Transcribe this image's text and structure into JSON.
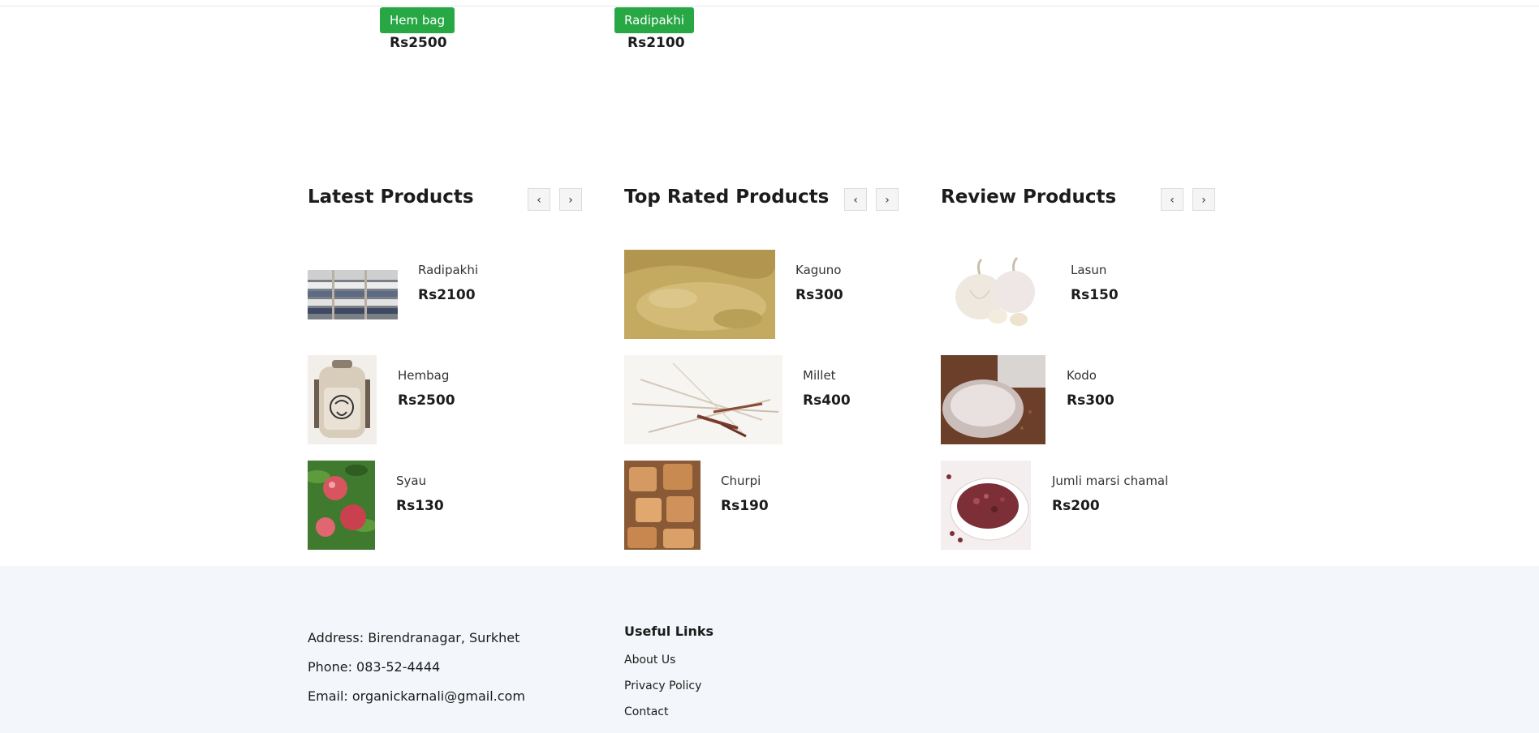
{
  "featured": [
    {
      "tag": "Hem bag",
      "price": "Rs2500"
    },
    {
      "tag": "Radipakhi",
      "price": "Rs2100"
    }
  ],
  "sections": [
    {
      "title": "Latest Products",
      "prev": "‹",
      "next": "›",
      "items": [
        {
          "name": "Radipakhi",
          "price": "Rs2100",
          "image": "folded-blankets"
        },
        {
          "name": "Hembag",
          "price": "Rs2500",
          "image": "hemp-backpack"
        },
        {
          "name": "Syau",
          "price": "Rs130",
          "image": "apples"
        }
      ]
    },
    {
      "title": "Top Rated Products",
      "prev": "‹",
      "next": "›",
      "items": [
        {
          "name": "Kaguno",
          "price": "Rs300",
          "image": "millet-grain"
        },
        {
          "name": "Millet",
          "price": "Rs400",
          "image": "millet-stalks"
        },
        {
          "name": "Churpi",
          "price": "Rs190",
          "image": "cheese-cubes"
        }
      ]
    },
    {
      "title": "Review Products",
      "prev": "‹",
      "next": "›",
      "items": [
        {
          "name": "Lasun",
          "price": "Rs150",
          "image": "garlic"
        },
        {
          "name": "Kodo",
          "price": "Rs300",
          "image": "flour-bowl"
        },
        {
          "name": "Jumli marsi chamal",
          "price": "Rs200",
          "image": "red-rice"
        }
      ]
    }
  ],
  "footer": {
    "address": "Address: Birendranagar, Surkhet",
    "phone": "Phone: 083-52-4444",
    "email": "Email: organickarnali@gmail.com",
    "useful_links_title": "Useful Links",
    "links": [
      "About Us",
      "Privacy Policy",
      "Contact"
    ]
  },
  "colors": {
    "accent": "#28a745",
    "footer_bg": "#f3f6fa"
  }
}
